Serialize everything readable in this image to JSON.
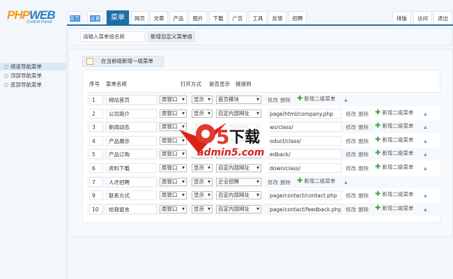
{
  "logo": {
    "brand_a": "PHP",
    "brand_b": "WEB",
    "tagline": "Control Panel"
  },
  "tabs": [
    {
      "label": "首页",
      "state": "highlighted"
    },
    {
      "label": "设置",
      "state": "highlighted"
    },
    {
      "label": "菜单",
      "state": "active"
    },
    {
      "label": "网页"
    },
    {
      "label": "文章"
    },
    {
      "label": "产品"
    },
    {
      "label": "图片"
    },
    {
      "label": "下载"
    },
    {
      "label": "广告"
    },
    {
      "label": "工具"
    },
    {
      "label": "反馈"
    },
    {
      "label": "招聘"
    }
  ],
  "right_tabs": [
    "排版",
    "访问",
    "退出"
  ],
  "sidebar": {
    "items": [
      {
        "label": "频道导航菜单",
        "active": true
      },
      {
        "label": "顶部导航菜单"
      },
      {
        "label": "底部导航菜单"
      }
    ]
  },
  "toolbar": {
    "group_name_input": "请输入菜单组名称",
    "add_group_button": "新增自定义菜单组"
  },
  "panel": {
    "add_top_menu_button": "在当前组新增一级菜单"
  },
  "table": {
    "headers": {
      "index": "序号",
      "name": "菜单名称",
      "open": "打开方式",
      "show": "是否显示",
      "link": "链接到"
    },
    "actions": {
      "edit": "修改",
      "delete": "删除",
      "add_sub": "新增二级菜单"
    },
    "rows": [
      {
        "index": "1",
        "name": "网站首页",
        "open": "原窗口",
        "show": "显示",
        "link_type": "首页模块",
        "url": ""
      },
      {
        "index": "2",
        "name": "公司简介",
        "open": "原窗口",
        "show": "显示",
        "link_type": "自定内部网址",
        "url": "page/html/company.php"
      },
      {
        "index": "3",
        "name": "新闻动态",
        "open": "原窗口",
        "show": "显示",
        "link_type": "自定内部网址",
        "url": "ws/class/"
      },
      {
        "index": "4",
        "name": "产品展示",
        "open": "原窗口",
        "show": "显示",
        "link_type": "自定内部网址",
        "url": "oduct/class/"
      },
      {
        "index": "5",
        "name": "产品订购",
        "open": "原窗口",
        "show": "显示",
        "link_type": "自定内部网址",
        "url": "edback/"
      },
      {
        "index": "6",
        "name": "资料下载",
        "open": "原窗口",
        "show": "显示",
        "link_type": "自定内部网址",
        "url": "down/class/"
      },
      {
        "index": "7",
        "name": "人才招聘",
        "open": "原窗口",
        "show": "显示",
        "link_type": "企业招聘",
        "url": ""
      },
      {
        "index": "9",
        "name": "联系方式",
        "open": "原窗口",
        "show": "显示",
        "link_type": "自定内部网址",
        "url": "page/contact/contact.php"
      },
      {
        "index": "10",
        "name": "给我留言",
        "open": "原窗口",
        "show": "显示",
        "link_type": "自定内部网址",
        "url": "page/contact/feedback.php"
      }
    ]
  },
  "watermark": {
    "text": "a5下载",
    "url": "admin5.com"
  },
  "colors": {
    "accent": "#1c6ea4",
    "background": "#f3f7fb",
    "add_icon": "#3ba33b"
  }
}
